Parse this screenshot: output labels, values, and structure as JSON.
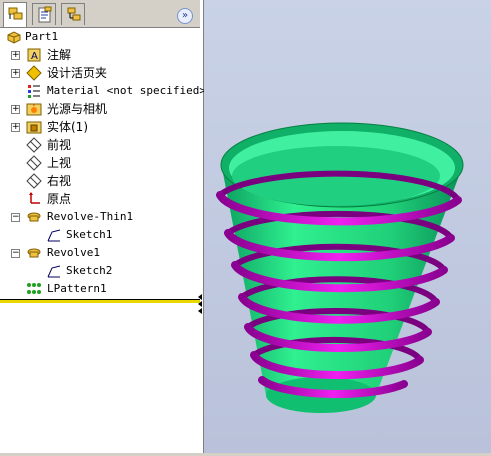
{
  "tabs": [
    {
      "name": "featuremanager",
      "icon": "featuremanager-tab-icon",
      "active": true
    },
    {
      "name": "propertymanager",
      "icon": "propertymanager-tab-icon",
      "active": false
    },
    {
      "name": "configurationmanager",
      "icon": "configurationmanager-tab-icon",
      "active": false
    }
  ],
  "collapse_icon": "»",
  "tree": {
    "root": "Part1",
    "items": [
      {
        "label": "注解",
        "expander": "+"
      },
      {
        "label": "设计活页夹",
        "expander": "+"
      },
      {
        "label": "Material <not specified>",
        "expander": ""
      },
      {
        "label": "光源与相机",
        "expander": "+"
      },
      {
        "label": "实体(1)",
        "expander": "+"
      },
      {
        "label": "前视",
        "expander": ""
      },
      {
        "label": "上视",
        "expander": ""
      },
      {
        "label": "右视",
        "expander": ""
      },
      {
        "label": "原点",
        "expander": ""
      },
      {
        "label": "Revolve-Thin1",
        "expander": "−"
      },
      {
        "label": "Sketch1",
        "expander": ""
      },
      {
        "label": "Revolve1",
        "expander": "−"
      },
      {
        "label": "Sketch2",
        "expander": ""
      },
      {
        "label": "LPattern1",
        "expander": ""
      }
    ]
  },
  "colors": {
    "cup": "#20e080",
    "spring": "#d000d0",
    "rollback_bar": "#e8d800",
    "viewport_bg": "#c2cbe0"
  }
}
